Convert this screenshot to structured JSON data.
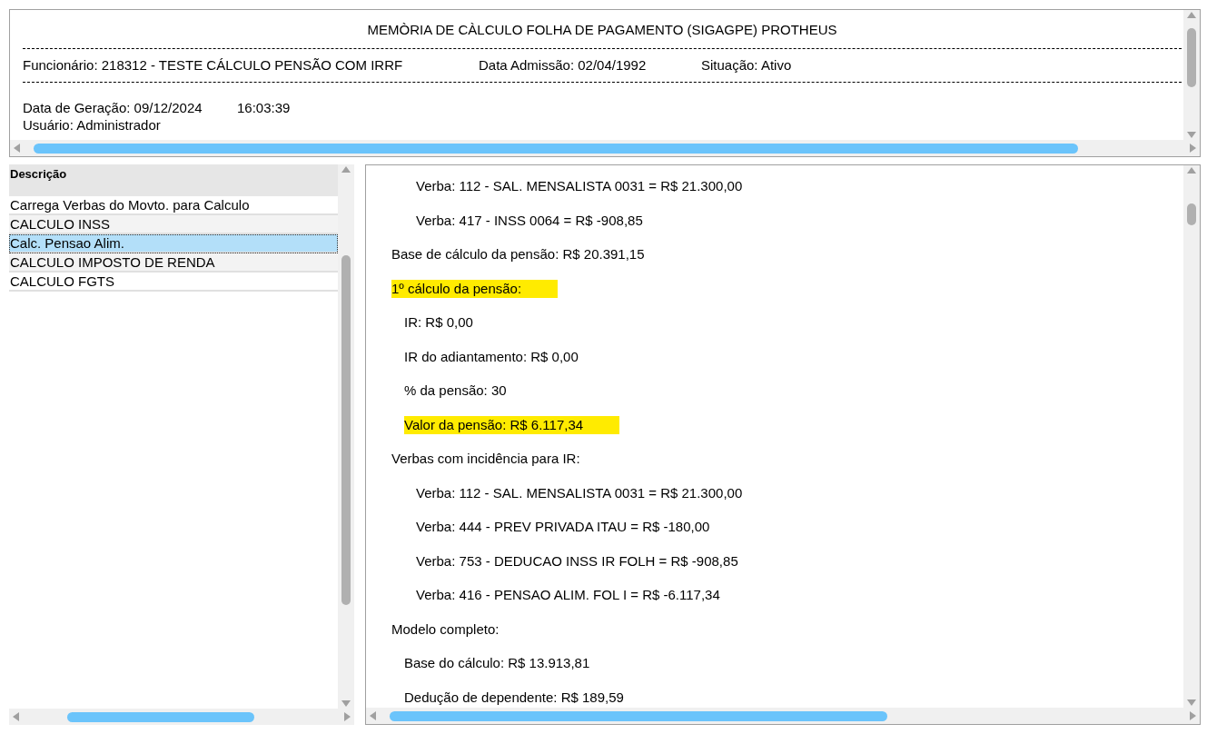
{
  "header": {
    "title": "MEMÒRIA DE CÀLCULO FOLHA DE PAGAMENTO (SIGAGPE) PROTHEUS",
    "employee": "Funcionário: 218312 - TESTE CÁLCULO PENSÃO COM IRRF",
    "admission": "Data Admissão: 02/04/1992",
    "status": "Situação: Ativo",
    "generated": "Data de Geração: 09/12/2024",
    "time": "16:03:39",
    "user": "Usuário: Administrador"
  },
  "steps": {
    "column": "Descrição",
    "rows": [
      {
        "label": "Carrega Verbas do Movto. para Calculo",
        "selected": false
      },
      {
        "label": "CALCULO INSS",
        "selected": false
      },
      {
        "label": "Calc. Pensao Alim.",
        "selected": true
      },
      {
        "label": "CALCULO IMPOSTO DE RENDA",
        "selected": false
      },
      {
        "label": "CALCULO FGTS",
        "selected": false
      }
    ]
  },
  "details": [
    {
      "kind": "item",
      "text": "Verba: 112 - SAL. MENSALISTA 0031 = R$ 21.300,00",
      "highlighted": false
    },
    {
      "kind": "item",
      "text": "Verba: 417 - INSS 0064 = R$ -908,85",
      "highlighted": false
    },
    {
      "kind": "heading",
      "text": "Base de cálculo da pensão: R$ 20.391,15",
      "highlighted": false
    },
    {
      "kind": "heading",
      "text": "1º cálculo da pensão:",
      "highlighted": true
    },
    {
      "kind": "value",
      "text": "IR: R$ 0,00",
      "highlighted": false
    },
    {
      "kind": "value",
      "text": "IR do adiantamento: R$ 0,00",
      "highlighted": false
    },
    {
      "kind": "value",
      "text": "% da pensão: 30",
      "highlighted": false
    },
    {
      "kind": "value",
      "text": "Valor da pensão: R$ 6.117,34",
      "highlighted": true
    },
    {
      "kind": "heading",
      "text": "Verbas com incidência para IR:",
      "highlighted": false
    },
    {
      "kind": "item",
      "text": "Verba: 112 - SAL. MENSALISTA 0031 = R$ 21.300,00",
      "highlighted": false
    },
    {
      "kind": "item",
      "text": "Verba: 444 - PREV PRIVADA ITAU = R$ -180,00",
      "highlighted": false
    },
    {
      "kind": "item",
      "text": "Verba: 753 - DEDUCAO INSS IR FOLH = R$ -908,85",
      "highlighted": false
    },
    {
      "kind": "item",
      "text": "Verba: 416 - PENSAO ALIM. FOL I = R$ -6.117,34",
      "highlighted": false
    },
    {
      "kind": "heading",
      "text": "Modelo completo:",
      "highlighted": false
    },
    {
      "kind": "value",
      "text": "Base do cálculo: R$ 13.913,81",
      "highlighted": false
    },
    {
      "kind": "value",
      "text": "Dedução de dependente: R$ 189,59",
      "highlighted": false
    }
  ]
}
